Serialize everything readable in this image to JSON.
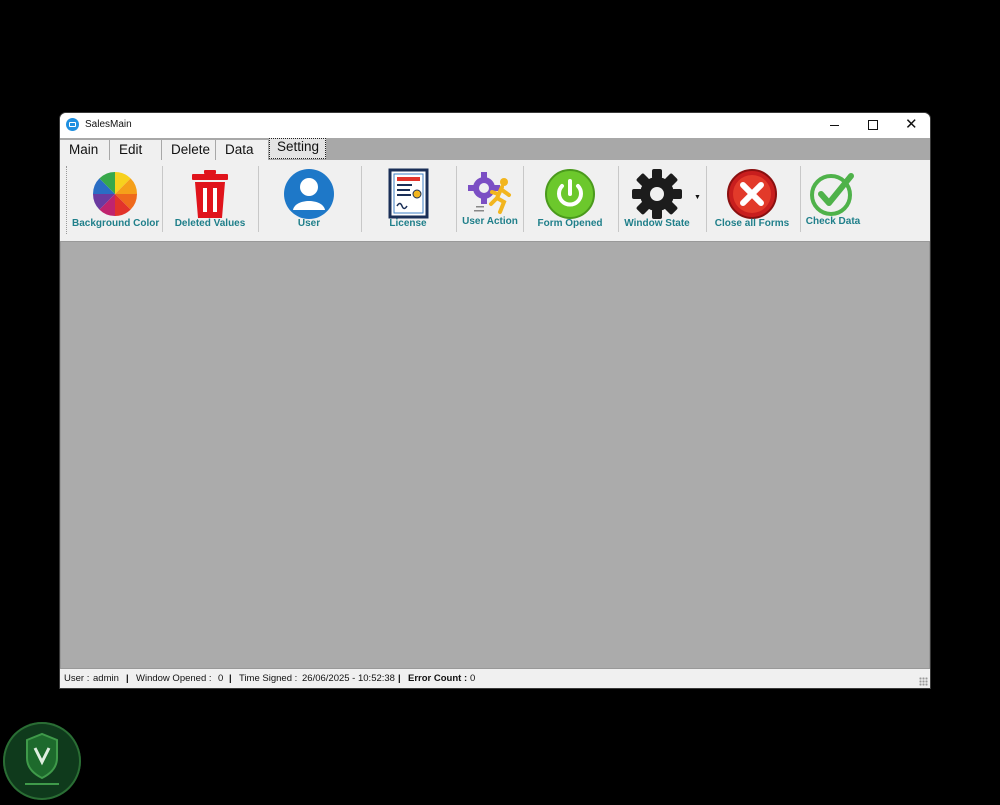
{
  "window": {
    "title": "SalesMain"
  },
  "tabs": [
    {
      "label": "Main"
    },
    {
      "label": "Edit"
    },
    {
      "label": "Delete"
    },
    {
      "label": "Data"
    },
    {
      "label": "Setting"
    }
  ],
  "ribbon": {
    "background_color": "Background Color",
    "deleted_values": "Deleted Values",
    "user": "User",
    "license": "License",
    "user_action": "User Action",
    "form_opened": "Form Opened",
    "window_state": "Window State",
    "close_all_forms": "Close all Forms",
    "check_data": "Check Data"
  },
  "status": {
    "user_label": "User :",
    "user_value": "admin",
    "sep": "|",
    "window_opened_label": "Window Opened :",
    "window_opened_value": "0",
    "time_signed_label": "Time Signed :",
    "time_signed_value": "26/06/2025 - 10:52:38",
    "error_count_label": "Error Count :",
    "error_count_value": "0"
  },
  "colors": {
    "label_teal": "#1f7f8a",
    "mdi_gray": "#ababab",
    "tab_strip": "#a8a8a8",
    "delete_red": "#e0141c",
    "user_blue": "#1e78c8",
    "power_green": "#6cc82c",
    "close_red": "#c81e1e",
    "check_green": "#4fb24a"
  }
}
